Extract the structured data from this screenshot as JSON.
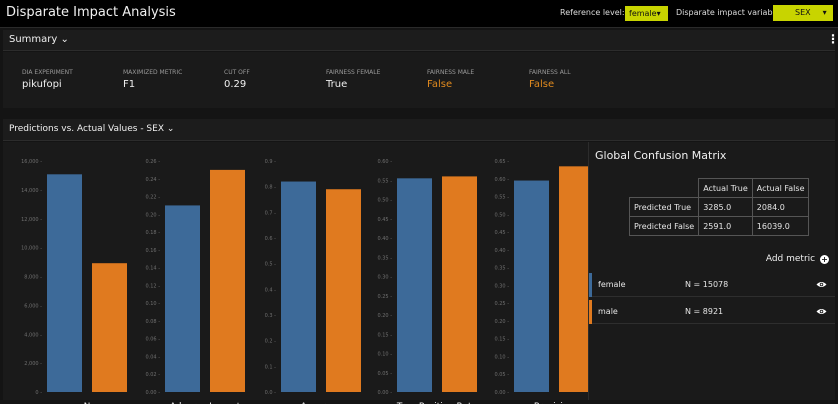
{
  "app": {
    "title": "Disparate Impact Analysis",
    "reference_level_label": "Reference level:",
    "reference_level_value": "female",
    "dia_variable_label": "Disparate impact variable:",
    "dia_variable_value": "SEX"
  },
  "summary": {
    "title": "Summary",
    "stats": [
      {
        "label": "DIA EXPERIMENT",
        "value": "pikufopi",
        "warn": false
      },
      {
        "label": "MAXIMIZED METRIC",
        "value": "F1",
        "warn": false
      },
      {
        "label": "CUT OFF",
        "value": "0.29",
        "warn": false
      },
      {
        "label": "FAIRNESS FEMALE",
        "value": "True",
        "warn": false
      },
      {
        "label": "FAIRNESS MALE",
        "value": "False",
        "warn": true
      },
      {
        "label": "FAIRNESS ALL",
        "value": "False",
        "warn": true
      }
    ]
  },
  "predictions": {
    "title": "Predictions vs. Actual Values - SEX"
  },
  "chart_data": {
    "type": "bar",
    "series": [
      {
        "name": "female",
        "color": "#3d6a99"
      },
      {
        "name": "male",
        "color": "#e07a1f"
      }
    ],
    "panels": [
      {
        "metric": "N",
        "values": [
          15078,
          8921
        ],
        "ylim": [
          0,
          16000
        ],
        "ticks": [
          "0",
          "2,000",
          "4,000",
          "6,000",
          "8,000",
          "10,000",
          "12,000",
          "14,000",
          "16,000"
        ]
      },
      {
        "metric": "Adverse Impact",
        "values": [
          0.21,
          0.25
        ],
        "ylim": [
          0,
          0.26
        ],
        "ticks": [
          "0.00",
          "0.02",
          "0.04",
          "0.06",
          "0.08",
          "0.10",
          "0.12",
          "0.14",
          "0.16",
          "0.18",
          "0.20",
          "0.22",
          "0.24",
          "0.26"
        ]
      },
      {
        "metric": "Accuracy",
        "values": [
          0.82,
          0.79
        ],
        "ylim": [
          0,
          0.9
        ],
        "ticks": [
          "0.0",
          "0.1",
          "0.2",
          "0.3",
          "0.4",
          "0.5",
          "0.6",
          "0.7",
          "0.8",
          "0.9"
        ]
      },
      {
        "metric": "True Positive Rate",
        "values": [
          0.555,
          0.56
        ],
        "ylim": [
          0,
          0.6
        ],
        "ticks": [
          "0.00",
          "0.05",
          "0.10",
          "0.15",
          "0.20",
          "0.25",
          "0.30",
          "0.35",
          "0.40",
          "0.45",
          "0.50",
          "0.55",
          "0.60"
        ]
      },
      {
        "metric": "Precision",
        "values": [
          0.595,
          0.635
        ],
        "ylim": [
          0,
          0.65
        ],
        "ticks": [
          "0.00",
          "0.05",
          "0.10",
          "0.15",
          "0.20",
          "0.25",
          "0.30",
          "0.35",
          "0.40",
          "0.45",
          "0.50",
          "0.55",
          "0.60",
          "0.65"
        ]
      }
    ]
  },
  "confusion_matrix": {
    "title": "Global Confusion Matrix",
    "col_headers": [
      "Actual True",
      "Actual False"
    ],
    "rows": [
      {
        "label": "Predicted True",
        "values": [
          "3285.0",
          "2084.0"
        ]
      },
      {
        "label": "Predicted False",
        "values": [
          "2591.0",
          "16039.0"
        ]
      }
    ]
  },
  "add_metric_label": "Add metric",
  "groups": [
    {
      "name": "female",
      "n_text": "N = 15078",
      "color": "#3d6a99"
    },
    {
      "name": "male",
      "n_text": "N = 8921",
      "color": "#e07a1f"
    }
  ]
}
